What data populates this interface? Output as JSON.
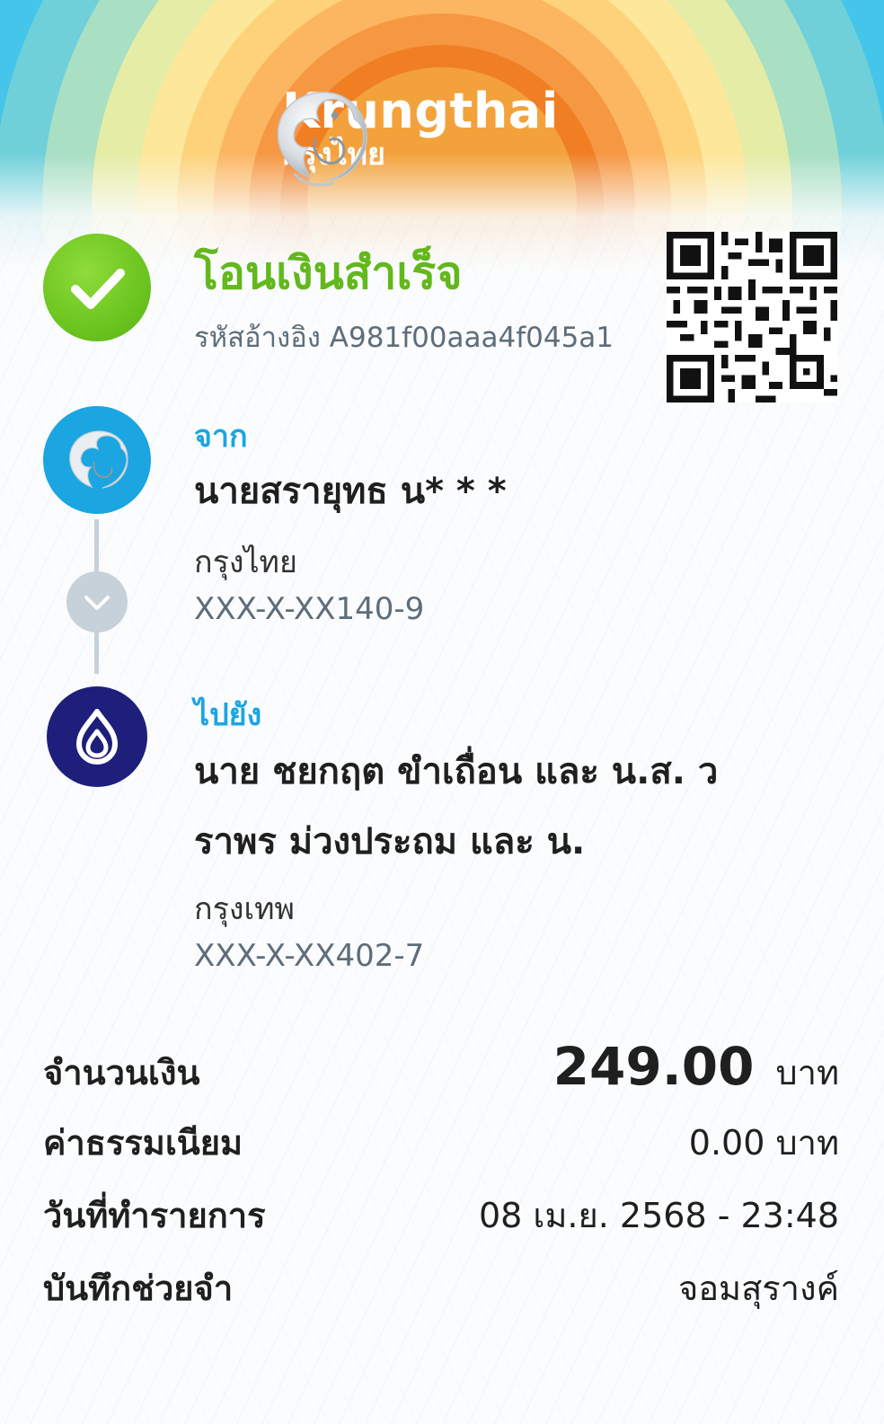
{
  "header": {
    "brand_en": "Krungthai",
    "brand_th": "กรุงไทย"
  },
  "status": {
    "title": "โอนเงินสำเร็จ",
    "reference": "รหัสอ้างอิง A981f00aaa4f045a1",
    "color": "#62b81c"
  },
  "from": {
    "label": "จาก",
    "name": "นายสรายุทธ น* * *",
    "bank": "กรุงไทย",
    "account": "XXX-X-XX140-9",
    "bank_color": "#1ba5e1"
  },
  "to": {
    "label": "ไปยัง",
    "name_line1": "นาย ชยกฤต ขำเถื่อน และ น.ส. ว",
    "name_line2": "ราพร ม่วงประถม และ น.",
    "bank": "กรุงเทพ",
    "account": "XXX-X-XX402-7",
    "bank_color": "#1e1f7a"
  },
  "details": {
    "amount_label": "จำนวนเงิน",
    "amount_value": "249.00",
    "amount_unit": "บาท",
    "fee_label": "ค่าธรรมเนียม",
    "fee_value": "0.00 บาท",
    "date_label": "วันที่ทำรายการ",
    "date_value": "08 เม.ย. 2568 - 23:48",
    "memo_label": "บันทึกช่วยจำ",
    "memo_value": "จอมสุรางค์"
  },
  "icons": {
    "status": "check-icon",
    "from_bank": "krungthai-logo-icon",
    "to_bank": "bangkok-bank-logo-icon",
    "connector": "chevron-down-icon",
    "qr": "qr-code"
  }
}
